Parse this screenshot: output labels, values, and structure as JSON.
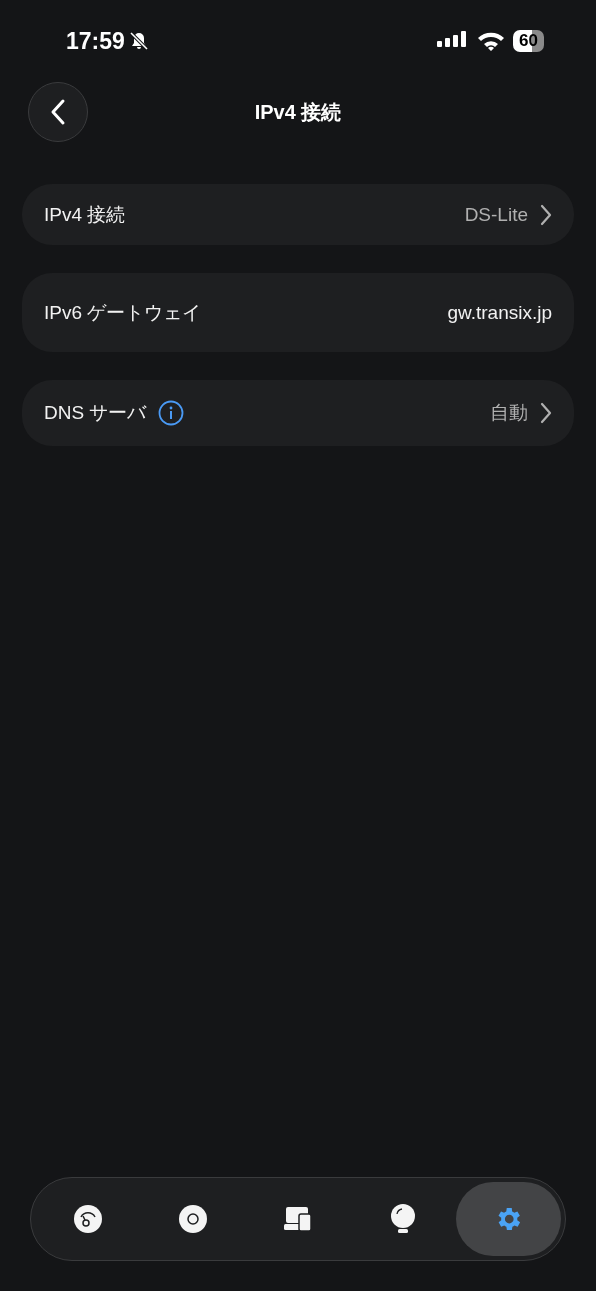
{
  "status_bar": {
    "time": "17:59",
    "silent": true,
    "battery": "60"
  },
  "header": {
    "title": "IPv4 接続"
  },
  "rows": [
    {
      "kind": "link",
      "label": "IPv4 接続",
      "value": "DS-Lite",
      "info": false
    },
    {
      "kind": "value",
      "label": "IPv6 ゲートウェイ",
      "value": "gw.transix.jp",
      "info": false
    },
    {
      "kind": "link",
      "label": "DNS サーバ",
      "value": "自動",
      "info": true
    }
  ],
  "tab_bar": [
    {
      "kind": "gauge",
      "selected": false
    },
    {
      "kind": "disc",
      "selected": false
    },
    {
      "kind": "devices",
      "selected": false
    },
    {
      "kind": "bulb",
      "selected": false
    },
    {
      "kind": "gear",
      "selected": true
    }
  ]
}
